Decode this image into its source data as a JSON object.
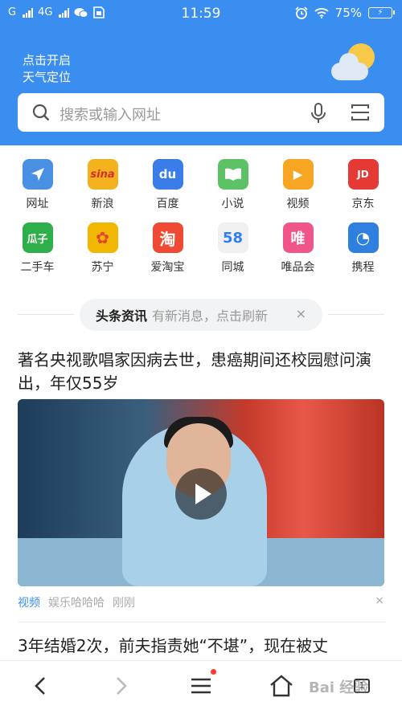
{
  "status_bar": {
    "carrier_1": "G",
    "carrier_2": "4G",
    "time": "11:59",
    "battery": "75%",
    "icons": [
      "signal-icon",
      "wechat-icon",
      "sim-icon",
      "alarm-icon",
      "wifi-icon",
      "battery-icon"
    ]
  },
  "header": {
    "weather_line1": "点击开启",
    "weather_line2": "天气定位",
    "weather_icon": "sun-cloud-icon",
    "bg_color": "#3a8ef0"
  },
  "search": {
    "placeholder": "搜索或输入网址"
  },
  "apps": [
    {
      "label": "网址",
      "icon": "navigation-icon",
      "color": "#4a90e2"
    },
    {
      "label": "新浪",
      "icon": "sina-icon",
      "color": "#f3b21d",
      "glyph": "sina"
    },
    {
      "label": "百度",
      "icon": "baidu-icon",
      "color": "#3a7ce8",
      "glyph": "du"
    },
    {
      "label": "小说",
      "icon": "book-icon",
      "color": "#5dc266",
      "glyph": "▯"
    },
    {
      "label": "视频",
      "icon": "play-icon",
      "color": "#f6a623",
      "glyph": "▶"
    },
    {
      "label": "京东",
      "icon": "jd-icon",
      "color": "#e53935",
      "glyph": "JD"
    },
    {
      "label": "二手车",
      "icon": "guazi-icon",
      "color": "#2eaf4a",
      "glyph": "瓜子"
    },
    {
      "label": "苏宁",
      "icon": "suning-icon",
      "color": "#f2b705",
      "glyph": "✿"
    },
    {
      "label": "爱淘宝",
      "icon": "taobao-icon",
      "color": "#ef4a33",
      "glyph": "淘"
    },
    {
      "label": "同城",
      "icon": "58-icon",
      "color": "#f0f0f0",
      "glyph": "58"
    },
    {
      "label": "唯品会",
      "icon": "vip-icon",
      "color": "#f0558a",
      "glyph": "唯"
    },
    {
      "label": "携程",
      "icon": "ctrip-icon",
      "color": "#2f7fe0",
      "glyph": "◔"
    }
  ],
  "refresh": {
    "tag": "头条资讯",
    "message": "有新消息，点击刷新",
    "close": "×"
  },
  "news": [
    {
      "title": "著名央视歌唱家因病去世，患癌期间还校园慰问演出，年仅55岁",
      "category": "视频",
      "source": "娱乐哈哈哈",
      "time": "刚刚",
      "close": "×"
    },
    {
      "title": "3年结婚2次，前夫指责她“不堪”，现在被丈"
    }
  ],
  "bottom_bar": {
    "tab_count": "1",
    "icons": [
      "back-icon",
      "forward-icon",
      "menu-icon",
      "home-icon",
      "tabs-icon"
    ]
  },
  "watermark": "Bai 经验"
}
